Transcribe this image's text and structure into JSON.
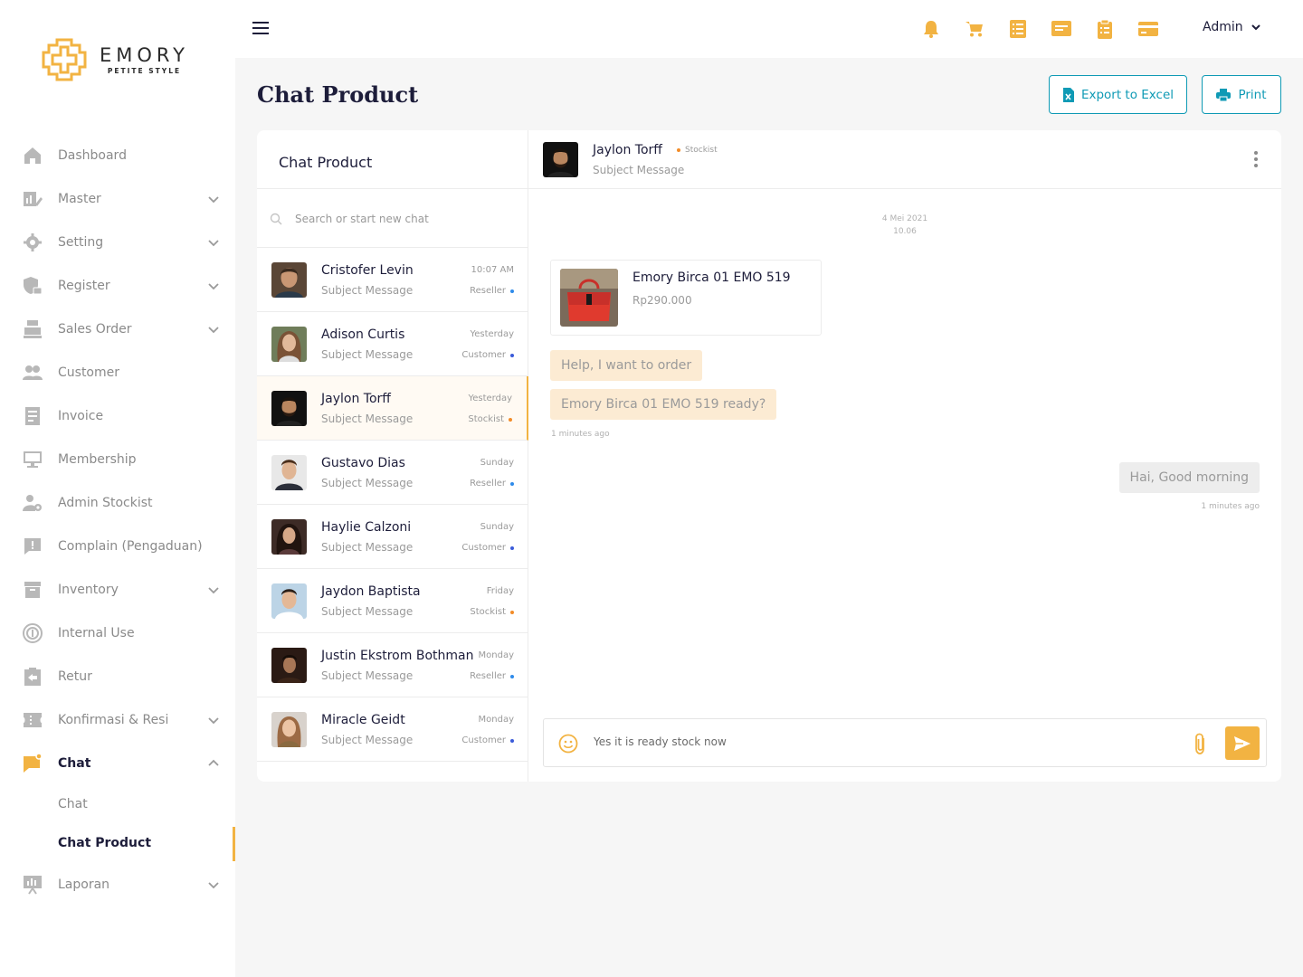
{
  "brand": {
    "name": "EMORY",
    "tagline": "PETITE STYLE",
    "accent": "#f2b342",
    "primary": "#0f9ab5"
  },
  "sidebar": {
    "items": [
      {
        "label": "Dashboard",
        "icon": "home-icon",
        "has_caret": false
      },
      {
        "label": "Master",
        "icon": "chart-edit-icon",
        "has_caret": true
      },
      {
        "label": "Setting",
        "icon": "gear-icon",
        "has_caret": true
      },
      {
        "label": "Register",
        "icon": "shield-lock-icon",
        "has_caret": true
      },
      {
        "label": "Sales Order",
        "icon": "cash-register-icon",
        "has_caret": true
      },
      {
        "label": "Customer",
        "icon": "users-icon",
        "has_caret": false
      },
      {
        "label": "Invoice",
        "icon": "invoice-icon",
        "has_caret": false
      },
      {
        "label": "Membership",
        "icon": "monitor-icon",
        "has_caret": false
      },
      {
        "label": "Admin Stockist",
        "icon": "user-gear-icon",
        "has_caret": false
      },
      {
        "label": "Complain (Pengaduan)",
        "icon": "alert-message-icon",
        "has_caret": false
      },
      {
        "label": "Inventory",
        "icon": "archive-icon",
        "has_caret": true
      },
      {
        "label": "Internal Use",
        "icon": "target-icon",
        "has_caret": false
      },
      {
        "label": "Retur",
        "icon": "return-clipboard-icon",
        "has_caret": false
      },
      {
        "label": "Konfirmasi & Resi",
        "icon": "ticket-icon",
        "has_caret": true
      },
      {
        "label": "Chat",
        "icon": "chat-icon",
        "has_caret": true,
        "expanded": true
      },
      {
        "label": "Laporan",
        "icon": "report-icon",
        "has_caret": true
      }
    ],
    "chat_sub": [
      {
        "label": "Chat"
      },
      {
        "label": "Chat Product",
        "active": true
      }
    ]
  },
  "topbar": {
    "icons": [
      "bell-icon",
      "cart-icon",
      "list-icon",
      "message-icon",
      "clipboard-icon",
      "card-icon"
    ],
    "user": "Admin"
  },
  "page": {
    "title": "Chat Product",
    "export_label": "Export to Excel",
    "print_label": "Print"
  },
  "chat_list": {
    "title": "Chat Product",
    "search_placeholder": "Search or start new chat",
    "contacts": [
      {
        "name": "Cristofer Levin",
        "subject": "Subject Message",
        "time": "10:07 AM",
        "role": "Reseller",
        "role_color": "#2e8bea"
      },
      {
        "name": "Adison Curtis",
        "subject": "Subject Message",
        "time": "Yesterday",
        "role": "Customer",
        "role_color": "#3a5bd9"
      },
      {
        "name": "Jaylon Torff",
        "subject": "Subject Message",
        "time": "Yesterday",
        "role": "Stockist",
        "role_color": "#f28c28",
        "selected": true
      },
      {
        "name": "Gustavo Dias",
        "subject": "Subject Message",
        "time": "Sunday",
        "role": "Reseller",
        "role_color": "#2e8bea"
      },
      {
        "name": "Haylie Calzoni",
        "subject": "Subject Message",
        "time": "Sunday",
        "role": "Customer",
        "role_color": "#3a5bd9"
      },
      {
        "name": "Jaydon Baptista",
        "subject": "Subject Message",
        "time": "Friday",
        "role": "Stockist",
        "role_color": "#f28c28"
      },
      {
        "name": "Justin Ekstrom Bothman",
        "subject": "Subject Message",
        "time": "Monday",
        "role": "Reseller",
        "role_color": "#2e8bea"
      },
      {
        "name": "Miracle Geidt",
        "subject": "Subject Message",
        "time": "Monday",
        "role": "Customer",
        "role_color": "#3a5bd9"
      }
    ]
  },
  "conversation": {
    "name": "Jaylon Torff",
    "role": "Stockist",
    "role_color": "#f28c28",
    "subject": "Subject Message",
    "date": "4 Mei 2021",
    "time": "10.06",
    "product": {
      "name": "Emory Birca 01 EMO 519",
      "price": "Rp290.000"
    },
    "incoming": [
      "Help, I want to order",
      "Emory Birca 01 EMO 519 ready?"
    ],
    "incoming_ago": "1 minutes ago",
    "outgoing": "Hai, Good morning",
    "outgoing_ago": "1 minutes ago",
    "composer_value": "Yes it is ready stock now"
  }
}
